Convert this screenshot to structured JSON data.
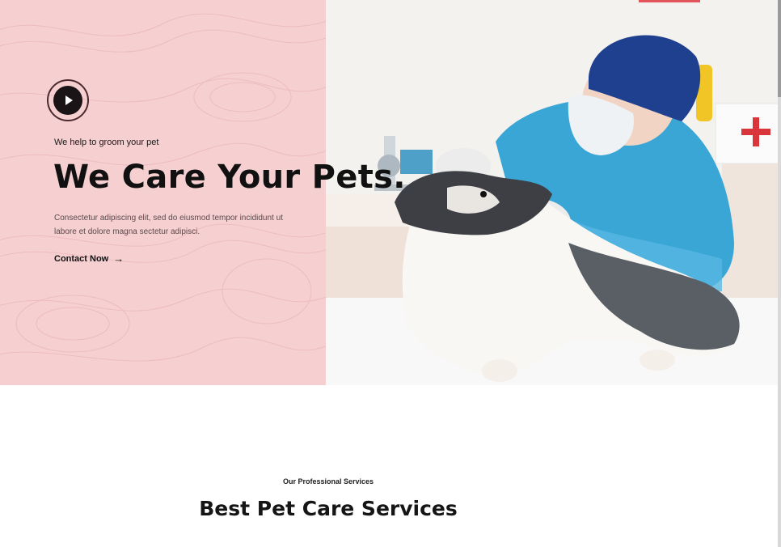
{
  "hero": {
    "eyebrow": "We help to groom your pet",
    "headline": "We Care Your Pets.",
    "description": "Consectetur adipiscing elit, sed do eiusmod tempor incididunt ut labore et dolore magna sectetur adipisci.",
    "cta_label": "Contact Now",
    "cta_icon": "arrow-right-icon",
    "play_icon": "play-icon",
    "image_alt": "veterinarian-examining-dog-photo"
  },
  "services": {
    "eyebrow": "Our Professional Services",
    "title": "Best Pet Care Services"
  },
  "colors": {
    "hero_left_bg": "#f6cfd1",
    "accent": "#e2535a",
    "text_dark": "#111111",
    "scrub_blue": "#3aa6d6",
    "cap_navy": "#1f3f8f"
  }
}
